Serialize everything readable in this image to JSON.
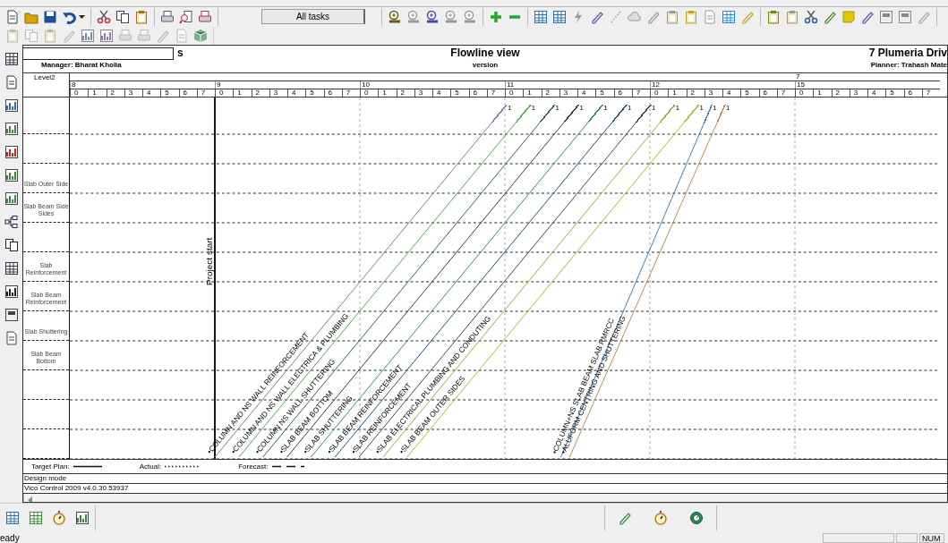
{
  "toolbar": {
    "filter_button": "All tasks"
  },
  "header": {
    "title_fragment": "s",
    "manager": "Manager: Bharat Kholia",
    "title": "Flowline view",
    "subtitle": "version",
    "project": "7 Plumeria Driv",
    "planner": "Planner: Trahash Mate"
  },
  "timeline": {
    "level_label": "Level2",
    "weeks": [
      {
        "label": "8",
        "days": [
          "0",
          "1",
          "2",
          "3",
          "4",
          "5",
          "6",
          "7"
        ]
      },
      {
        "label": "9",
        "days": [
          "0",
          "1",
          "2",
          "3",
          "4",
          "5",
          "6",
          "7"
        ]
      },
      {
        "label": "10",
        "days": [
          "0",
          "1",
          "2",
          "3",
          "4",
          "5",
          "6",
          "7"
        ]
      },
      {
        "label": "11",
        "days": [
          "0",
          "1",
          "2",
          "3",
          "4",
          "5",
          "6",
          "7"
        ]
      },
      {
        "label": "12",
        "days": [
          "0",
          "1",
          "2",
          "3",
          "4",
          "5",
          "6",
          "7"
        ]
      },
      {
        "label": "15",
        "level_label": "7",
        "days": [
          "0",
          "1",
          "2",
          "3",
          "4",
          "5",
          "6",
          "7"
        ]
      }
    ]
  },
  "rows": [
    {
      "kind": "blank"
    },
    {
      "kind": "blank"
    },
    {
      "kind": "labelled",
      "label": "Slab Outer Side"
    },
    {
      "kind": "labelled",
      "label": "Slab Beam Side Sides"
    },
    {
      "kind": "blank"
    },
    {
      "kind": "labelled",
      "label": "Slab Reinforcement"
    },
    {
      "kind": "labelled",
      "label": "Slab Beam Reinforcement"
    },
    {
      "kind": "labelled",
      "label": "Slab Shuttering"
    },
    {
      "kind": "labelled",
      "label": "Slab Beam Bottom"
    },
    {
      "kind": "blank"
    },
    {
      "kind": "blank"
    },
    {
      "kind": "blank"
    }
  ],
  "project_start": "Project start",
  "tasks": [
    {
      "label": "•COLUMN AND NS WALL REINFORCEMENT",
      "end_label": "1",
      "color": "#6b7fb5"
    },
    {
      "label": "•COLUMN AND NS WALL ELECTRICA & PLUMBING",
      "end_label": "1",
      "color": "#4caf50"
    },
    {
      "label": "•COLUMN NS WALL SHUTTERING",
      "end_label": "1",
      "color": "#2e6b3a"
    },
    {
      "label": "•SLAB BEAM BOTTOM",
      "end_label": "1",
      "color": "#333366"
    },
    {
      "label": "•SLAB SHUTTERING",
      "end_label": "1",
      "color": "#2d8a8a"
    },
    {
      "label": "•SLAB BEAM REINFORCEMENT",
      "end_label": "1",
      "color": "#1a4f8a"
    },
    {
      "label": "•SLAB REINFORCEMENT",
      "end_label": "1",
      "color": "#444444"
    },
    {
      "label": "•SLAB ELECTRICAL PLUMBING AND CONDUTING",
      "end_label": "1",
      "color": "#8fae3a"
    },
    {
      "label": "•SLAB BEAM OUTER SIDES",
      "end_label": "1",
      "color": "#b8b030"
    },
    {
      "label": "•COLUMN+NS SLAB BEAM SLAB RMRCC",
      "end_label": "1",
      "color": "#3a7fc0"
    },
    {
      "label": "•ALUFORM CENTRING AND SHUTTERING",
      "end_label": "1",
      "color": "#c08a50"
    }
  ],
  "legend": {
    "target": "Target Plan:",
    "actual": "Actual:",
    "forecast": "Forecast:"
  },
  "mode": "Design mode",
  "version": "Vico Control 2009 v4.0.30.53937",
  "status_bar": {
    "message": "eady",
    "indicator": "NUM"
  }
}
